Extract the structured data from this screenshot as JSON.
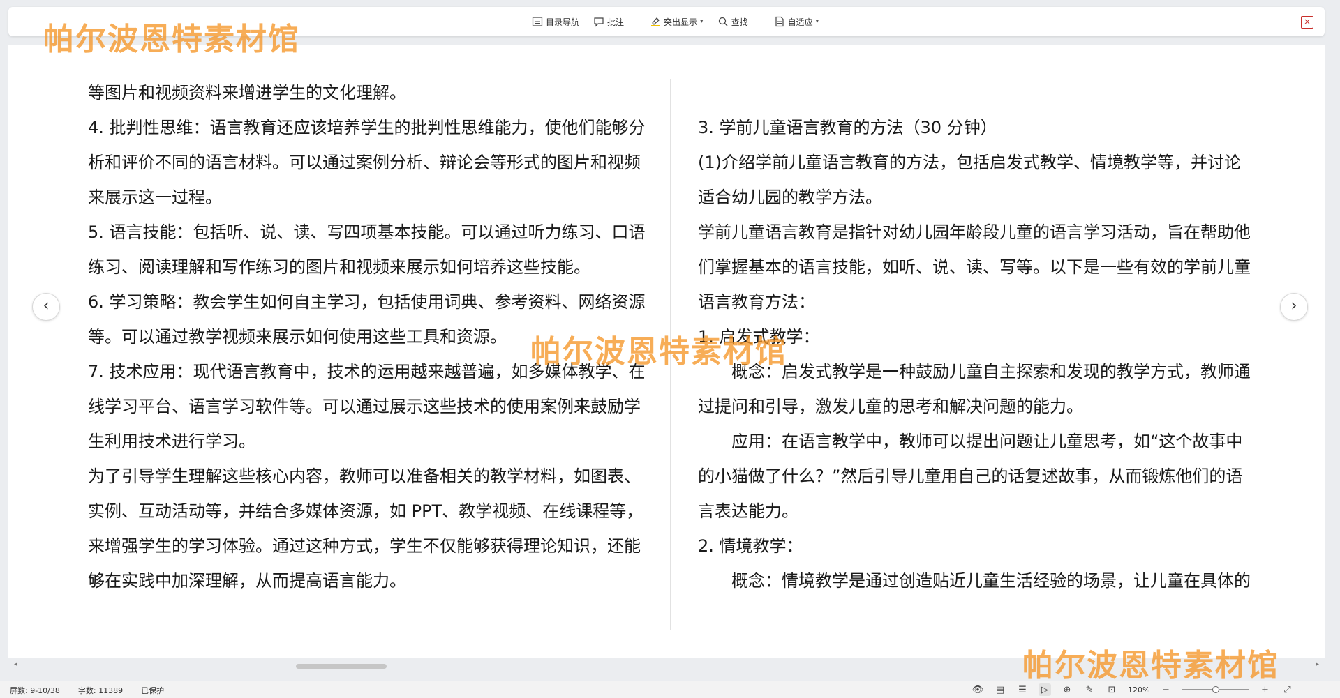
{
  "toolbar": {
    "items": [
      {
        "label": "目录导航",
        "icon": "toc-icon"
      },
      {
        "label": "批注",
        "icon": "comment-icon"
      },
      {
        "label": "突出显示",
        "icon": "highlight-icon"
      },
      {
        "label": "查找",
        "icon": "search-icon"
      },
      {
        "label": "自适应",
        "icon": "fit-page-icon"
      }
    ],
    "close_icon": "close-icon"
  },
  "watermark": "帕尔波恩特素材馆",
  "left_page": {
    "paragraphs": [
      "等图片和视频资料来增进学生的文化理解。",
      "4. 批判性思维：语言教育还应该培养学生的批判性思维能力，使他们能够分析和评价不同的语言材料。可以通过案例分析、辩论会等形式的图片和视频来展示这一过程。",
      "5. 语言技能：包括听、说、读、写四项基本技能。可以通过听力练习、口语练习、阅读理解和写作练习的图片和视频来展示如何培养这些技能。",
      "6. 学习策略：教会学生如何自主学习，包括使用词典、参考资料、网络资源等。可以通过教学视频来展示如何使用这些工具和资源。",
      "7. 技术应用：现代语言教育中，技术的运用越来越普遍，如多媒体教学、在线学习平台、语言学习软件等。可以通过展示这些技术的使用案例来鼓励学生利用技术进行学习。",
      "为了引导学生理解这些核心内容，教师可以准备相关的教学材料，如图表、实例、互动活动等，并结合多媒体资源，如 PPT、教学视频、在线课程等，来增强学生的学习体验。通过这种方式，学生不仅能够获得理论知识，还能够在实践中加深理解，从而提高语言能力。"
    ]
  },
  "right_page": {
    "paragraphs": [
      {
        "text": "3. 学前儿童语言教育的方法（30 分钟）",
        "indent": false
      },
      {
        "text": "(1)介绍学前儿童语言教育的方法，包括启发式教学、情境教学等，并讨论适合幼儿园的教学方法。",
        "indent": false
      },
      {
        "text": "学前儿童语言教育是指针对幼儿园年龄段儿童的语言学习活动，旨在帮助他们掌握基本的语言技能，如听、说、读、写等。以下是一些有效的学前儿童语言教育方法：",
        "indent": false
      },
      {
        "text": "1. 启发式教学：",
        "indent": false
      },
      {
        "text": "概念：启发式教学是一种鼓励儿童自主探索和发现的教学方式，教师通过提问和引导，激发儿童的思考和解决问题的能力。",
        "indent": true
      },
      {
        "text": "应用：在语言教学中，教师可以提出问题让儿童思考，如“这个故事中的小猫做了什么？”然后引导儿童用自己的话复述故事，从而锻炼他们的语言表达能力。",
        "indent": true
      },
      {
        "text": "2. 情境教学：",
        "indent": false
      },
      {
        "text": "概念：情境教学是通过创造贴近儿童生活经验的场景，让儿童在具体的",
        "indent": true
      }
    ]
  },
  "status": {
    "page": "屏数: 9-10/38",
    "words": "字数: 11389",
    "protected": "已保护",
    "zoom": "120%",
    "zoom_level": 0.5
  }
}
